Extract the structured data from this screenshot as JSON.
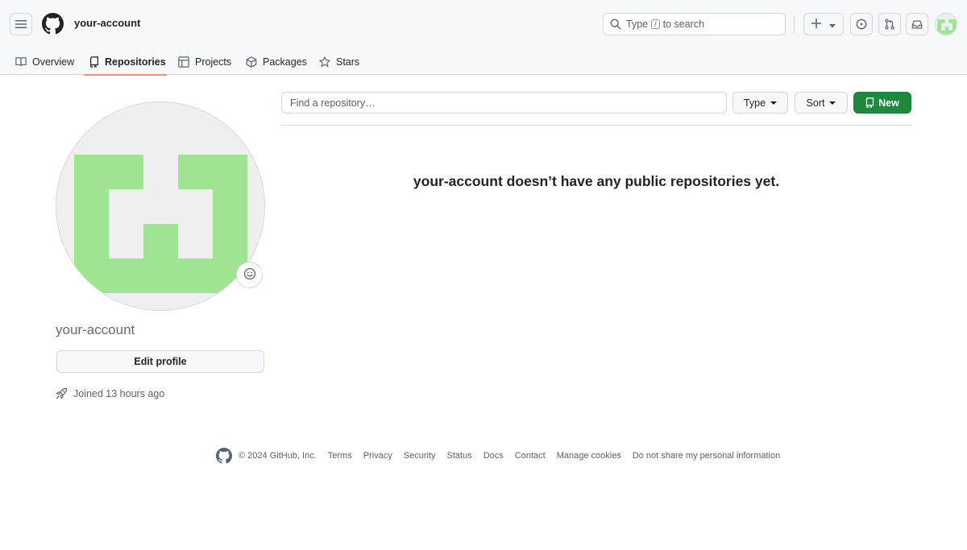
{
  "header": {
    "account": "your-account",
    "search": {
      "prefix": "Type",
      "key": "/",
      "suffix": "to search"
    },
    "icons": [
      "menu-icon",
      "github-logo",
      "search-icon",
      "plus-icon",
      "issues-icon",
      "pull-requests-icon",
      "inbox-icon"
    ]
  },
  "tabs": [
    {
      "label": "Overview",
      "icon": "book-icon"
    },
    {
      "label": "Repositories",
      "icon": "repo-icon",
      "selected": true
    },
    {
      "label": "Projects",
      "icon": "table-icon"
    },
    {
      "label": "Packages",
      "icon": "package-icon"
    },
    {
      "label": "Stars",
      "icon": "star-icon"
    }
  ],
  "profile": {
    "name": "your-account",
    "edit_label": "Edit profile",
    "joined": "Joined 13 hours ago"
  },
  "repos": {
    "search_placeholder": "Find a repository…",
    "type_label": "Type",
    "sort_label": "Sort",
    "new_label": "New",
    "empty_message": "your-account doesn’t have any public repositories yet."
  },
  "footer": {
    "copyright": "© 2024 GitHub, Inc.",
    "links": [
      "Terms",
      "Privacy",
      "Security",
      "Status",
      "Docs",
      "Contact",
      "Manage cookies",
      "Do not share my personal information"
    ]
  },
  "colors": {
    "accent_green": "#1f883d",
    "identicon": "#9ee493",
    "tab_underline": "#fd8c73"
  }
}
